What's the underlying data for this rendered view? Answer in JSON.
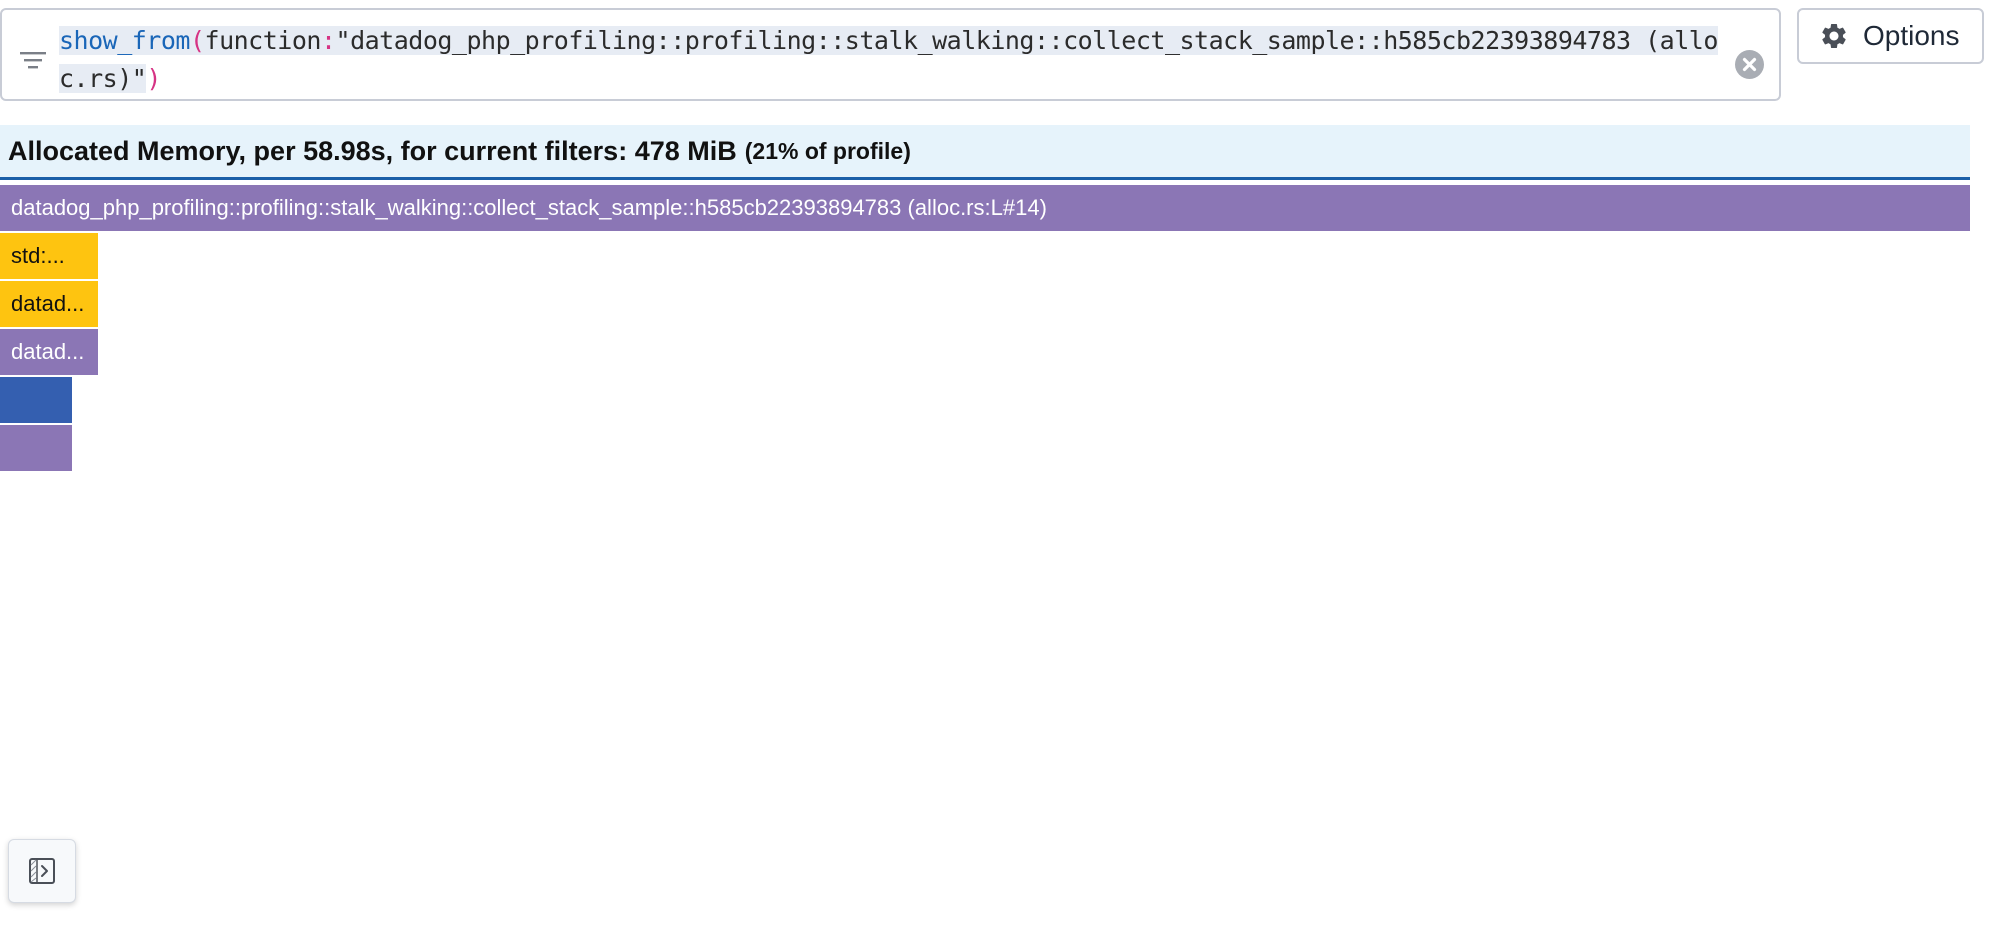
{
  "query": {
    "function_name": "show_from",
    "open_paren": "(",
    "key": "function",
    "colon": ":",
    "value": "\"datadog_php_profiling::profiling::stalk_walking::collect_stack_sample::h585cb22393894783 (alloc.rs)\"",
    "close_paren": ")"
  },
  "options": {
    "label": "Options"
  },
  "summary": {
    "main": "Allocated Memory, per 58.98s, for current filters: 478 MiB",
    "percent": "(21% of profile)"
  },
  "flamegraph": {
    "frames": [
      {
        "label": "datadog_php_profiling::profiling::stalk_walking::collect_stack_sample::h585cb22393894783 (alloc.rs:L#14)",
        "color": "#8b76b5"
      },
      {
        "label": "std:...",
        "color": "#fec410"
      },
      {
        "label": "datad...",
        "color": "#fec410"
      },
      {
        "label": "datad...",
        "color": "#8b76b5"
      },
      {
        "label": "",
        "color": "#345fb0"
      },
      {
        "label": "",
        "color": "#8b76b5"
      }
    ]
  },
  "icons": {
    "filter": "filter-lines-icon",
    "clear": "clear-x-circle-icon",
    "options": "gear-icon",
    "sidebar": "expand-panel-icon"
  }
}
